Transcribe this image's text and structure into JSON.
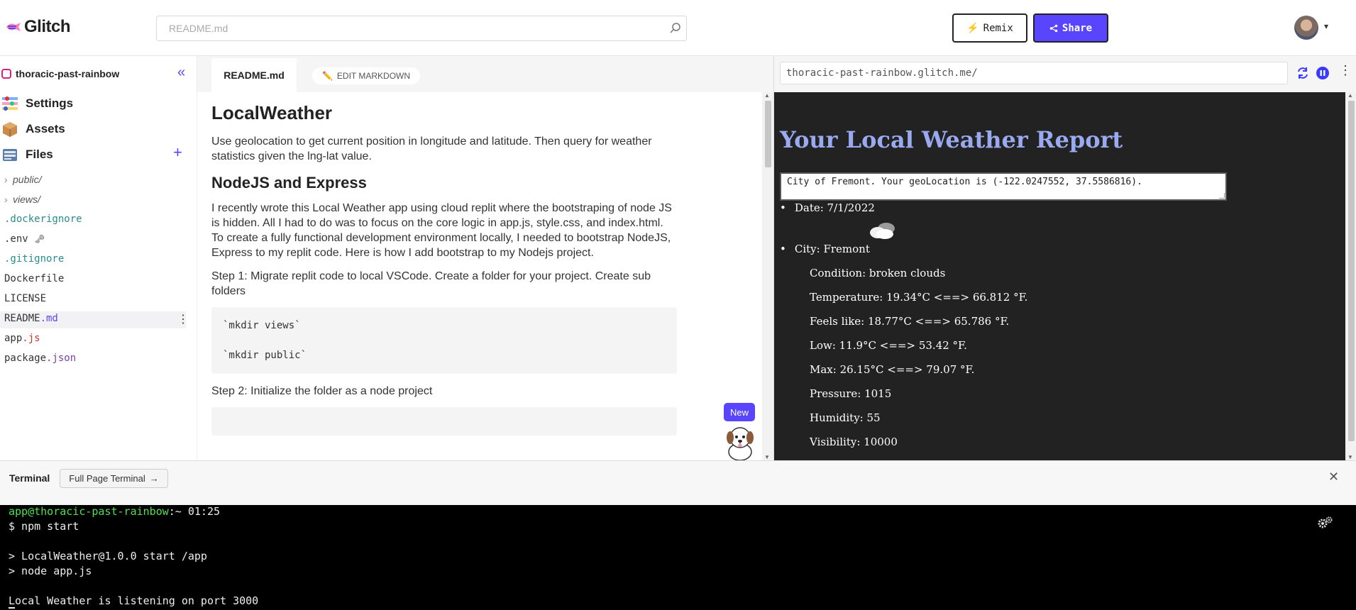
{
  "header": {
    "brand": "Glitch",
    "search_placeholder": "README.md",
    "remix_label": "Remix",
    "share_label": "Share"
  },
  "sidebar": {
    "project_name": "thoracic-past-rainbow",
    "nav": [
      {
        "label": "Settings"
      },
      {
        "label": "Assets"
      },
      {
        "label": "Files"
      }
    ],
    "files": [
      {
        "name": "public/"
      },
      {
        "name": "views/"
      },
      {
        "name": ".dockerignore"
      },
      {
        "name": ".env"
      },
      {
        "name": ".gitignore"
      },
      {
        "name": "Dockerfile"
      },
      {
        "name": "LICENSE"
      },
      {
        "name": "README",
        "ext": ".md"
      },
      {
        "name": "app",
        "ext": ".js"
      },
      {
        "name": "package",
        "ext": ".json"
      }
    ]
  },
  "editor": {
    "tab_label": "README.md",
    "edit_label": "EDIT MARKDOWN",
    "h1": "LocalWeather",
    "p1": "Use geolocation to get current position in longitude and latitude. Then query for weather statistics given the lng-lat value.",
    "h2": "NodeJS and Express",
    "p2": "I recently wrote this Local Weather app using cloud replit where the bootstraping of node JS is hidden. All I had to do was to focus on the core logic in app.js, style.css, and index.html. To create a fully functional development environment locally, I needed to bootstrap NodeJS, Express to my replit code. Here is how I add bootstrap to my Nodejs project.",
    "p3": "Step 1: Migrate replit code to local VSCode. Create a folder for your project. Create sub folders",
    "code1": "`mkdir views`",
    "code2": "`mkdir public`",
    "p4": "Step 2: Initialize the folder as a node project",
    "new_badge": "New"
  },
  "preview": {
    "url": "thoracic-past-rainbow.glitch.me/",
    "title": "Your Local Weather Report",
    "geo_text": "City of Fremont. Your geoLocation is (-122.0247552, 37.5586816).",
    "date": "Date: 7/1/2022",
    "city": "City: Fremont",
    "condition": "Condition: broken clouds",
    "temperature": "Temperature: 19.34°C <==> 66.812 °F.",
    "feels_like": "Feels like: 18.77°C <==> 65.786 °F.",
    "low": "Low: 11.9°C <==> 53.42 °F.",
    "max": "Max: 26.15°C <==> 79.07 °F.",
    "pressure": "Pressure: 1015",
    "humidity": "Humidity: 55",
    "visibility": "Visibility: 10000"
  },
  "terminal": {
    "title": "Terminal",
    "full_page_label": "Full Page Terminal",
    "prompt_user": "app@thoracic-past-rainbow",
    "prompt_rest": ":~ 01:25",
    "line1": "$ npm start",
    "line2": "> LocalWeather@1.0.0 start /app",
    "line3": "> node app.js",
    "line4": "Local Weather is listening on port 3000"
  },
  "colors": {
    "accent": "#5a45ff",
    "preview_bg": "#222222",
    "weather_title": "#9aaaf0"
  }
}
